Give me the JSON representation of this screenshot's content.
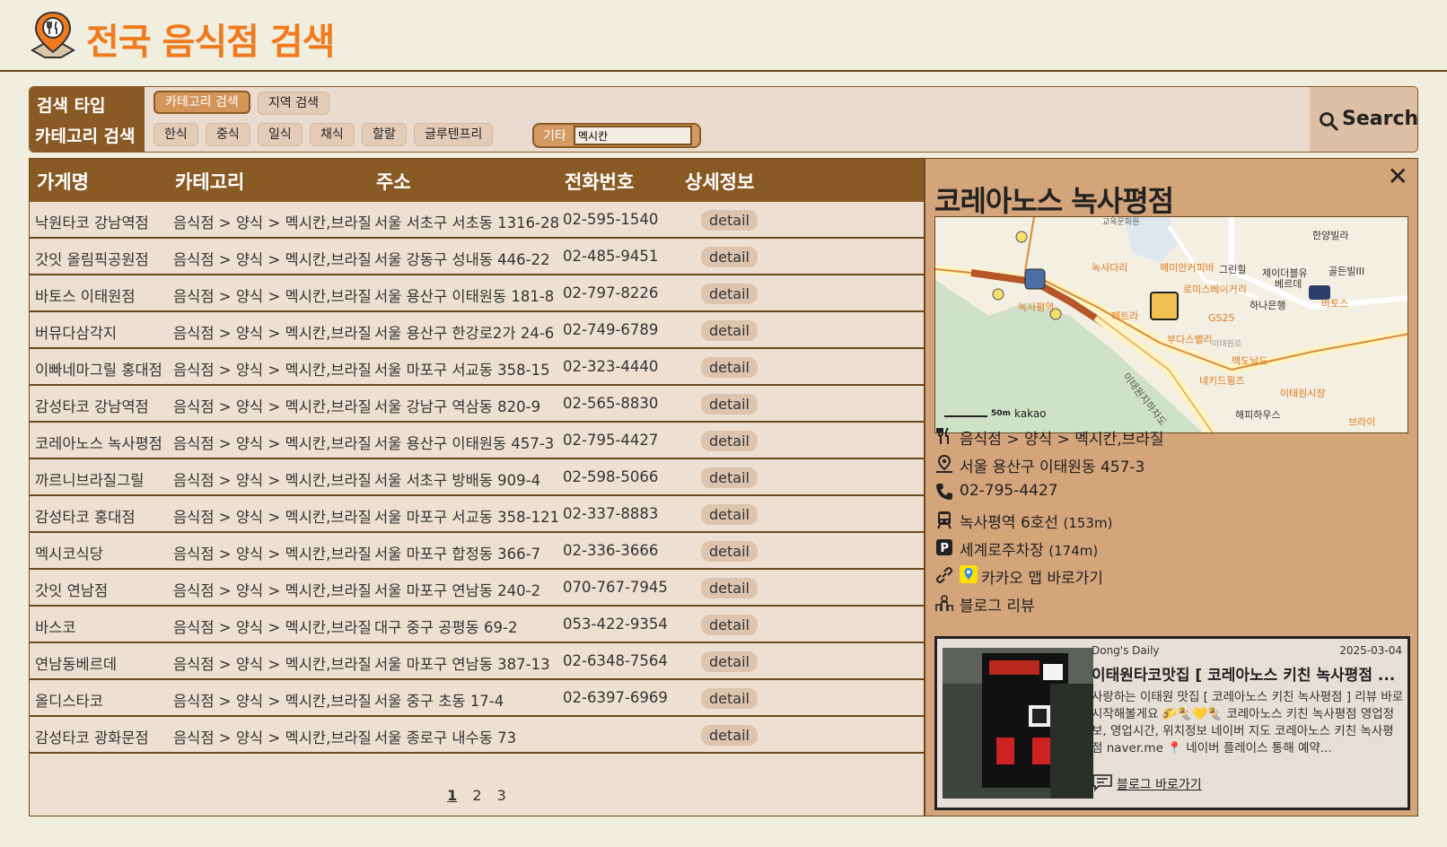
{
  "app": {
    "title": "전국 음식점 검색"
  },
  "search": {
    "type_label": "검색 타입",
    "category_label": "카테고리 검색",
    "types": [
      "카테고리 검색",
      "지역 검색"
    ],
    "categories": [
      "한식",
      "중식",
      "일식",
      "채식",
      "할랄",
      "글루텐프리"
    ],
    "other_label": "기타",
    "other_value": "멕시칸",
    "button_label": "Search"
  },
  "table": {
    "headers": [
      "가게명",
      "카테고리",
      "주소",
      "전화번호",
      "상세정보"
    ],
    "detail_label": "detail",
    "rows": [
      {
        "name": "낙원타코 강남역점",
        "category": "음식점 > 양식 > 멕시칸,브라질",
        "address": "서울 서초구 서초동 1316-28",
        "phone": "02-595-1540"
      },
      {
        "name": "갓잇 올림픽공원점",
        "category": "음식점 > 양식 > 멕시칸,브라질",
        "address": "서울 강동구 성내동 446-22",
        "phone": "02-485-9451"
      },
      {
        "name": "바토스 이태원점",
        "category": "음식점 > 양식 > 멕시칸,브라질",
        "address": "서울 용산구 이태원동 181-8",
        "phone": "02-797-8226"
      },
      {
        "name": "버뮤다삼각지",
        "category": "음식점 > 양식 > 멕시칸,브라질",
        "address": "서울 용산구 한강로2가 24-6",
        "phone": "02-749-6789"
      },
      {
        "name": "이빠네마그릴 홍대점",
        "category": "음식점 > 양식 > 멕시칸,브라질",
        "address": "서울 마포구 서교동 358-15",
        "phone": "02-323-4440"
      },
      {
        "name": "감성타코 강남역점",
        "category": "음식점 > 양식 > 멕시칸,브라질",
        "address": "서울 강남구 역삼동 820-9",
        "phone": "02-565-8830"
      },
      {
        "name": "코레아노스 녹사평점",
        "category": "음식점 > 양식 > 멕시칸,브라질",
        "address": "서울 용산구 이태원동 457-3",
        "phone": "02-795-4427"
      },
      {
        "name": "까르니브라질그릴",
        "category": "음식점 > 양식 > 멕시칸,브라질",
        "address": "서울 서초구 방배동 909-4",
        "phone": "02-598-5066"
      },
      {
        "name": "감성타코 홍대점",
        "category": "음식점 > 양식 > 멕시칸,브라질",
        "address": "서울 마포구 서교동 358-121",
        "phone": "02-337-8883"
      },
      {
        "name": "멕시코식당",
        "category": "음식점 > 양식 > 멕시칸,브라질",
        "address": "서울 마포구 합정동 366-7",
        "phone": "02-336-3666"
      },
      {
        "name": "갓잇 연남점",
        "category": "음식점 > 양식 > 멕시칸,브라질",
        "address": "서울 마포구 연남동 240-2",
        "phone": "070-767-7945"
      },
      {
        "name": "바스코",
        "category": "음식점 > 양식 > 멕시칸,브라질",
        "address": "대구 중구 공평동 69-2",
        "phone": "053-422-9354"
      },
      {
        "name": "연남동베르데",
        "category": "음식점 > 양식 > 멕시칸,브라질",
        "address": "서울 마포구 연남동 387-13",
        "phone": "02-6348-7564"
      },
      {
        "name": "올디스타코",
        "category": "음식점 > 양식 > 멕시칸,브라질",
        "address": "서울 중구 초동 17-4",
        "phone": "02-6397-6969"
      },
      {
        "name": "감성타코 광화문점",
        "category": "음식점 > 양식 > 멕시칸,브라질",
        "address": "서울 종로구 내수동 73",
        "phone": ""
      }
    ],
    "pages": [
      "1",
      "2",
      "3"
    ],
    "current_page": "1"
  },
  "detail": {
    "close": "✕",
    "title": "코레아노스 녹사평점",
    "category": "음식점 > 양식 > 멕시칸,브라질",
    "address": "서울 용산구 이태원동 457-3",
    "phone": "02-795-4427",
    "subway": "녹사평역 6호선",
    "subway_distance": "(153m)",
    "parking": "세계로주차장",
    "parking_distance": "(174m)",
    "kakao_link": "카카오 맵 바로가기",
    "blog_review": "블로그 리뷰",
    "map": {
      "scale": "50m",
      "brand": "kakao",
      "labels": [
        "한양빌라",
        "녹사다리",
        "헤미안커피바",
        "그린힐",
        "제이더블유",
        "베르데",
        "골든빌III",
        "로미스베이커리",
        "하나은행",
        "바토스",
        "녹사평역",
        "페트라",
        "GS25",
        "부다스벨리",
        "맥도날드",
        "네키드윙즈",
        "이태원시장",
        "해피하우스",
        "브라이",
        "이태원지하차도",
        "교육문화원",
        "이태원로"
      ]
    },
    "blog": {
      "author": "Dong's Daily",
      "date": "2025-03-04",
      "title": "이태원타코맛집 [ 코레아노스 키친 녹사평점 ...",
      "desc": "사랑하는 이태원 맛집 [ 코레아노스 키친 녹사평점 ] 리뷰 바로 시작해볼게요 🌮🌯💛🌯 코레아노스 키친 녹사평점 영업정보, 영업시간, 위치정보 네이버 지도 코레아노스 키친 녹사평점 naver.me 📍 네이버 플레이스 통해 예약...",
      "link": "블로그 바로가기"
    }
  },
  "colors": {
    "brand": "#f07a1e",
    "primary": "#8a5a24",
    "panel": "#d4a47a",
    "row_bg": "#ede0d3"
  }
}
